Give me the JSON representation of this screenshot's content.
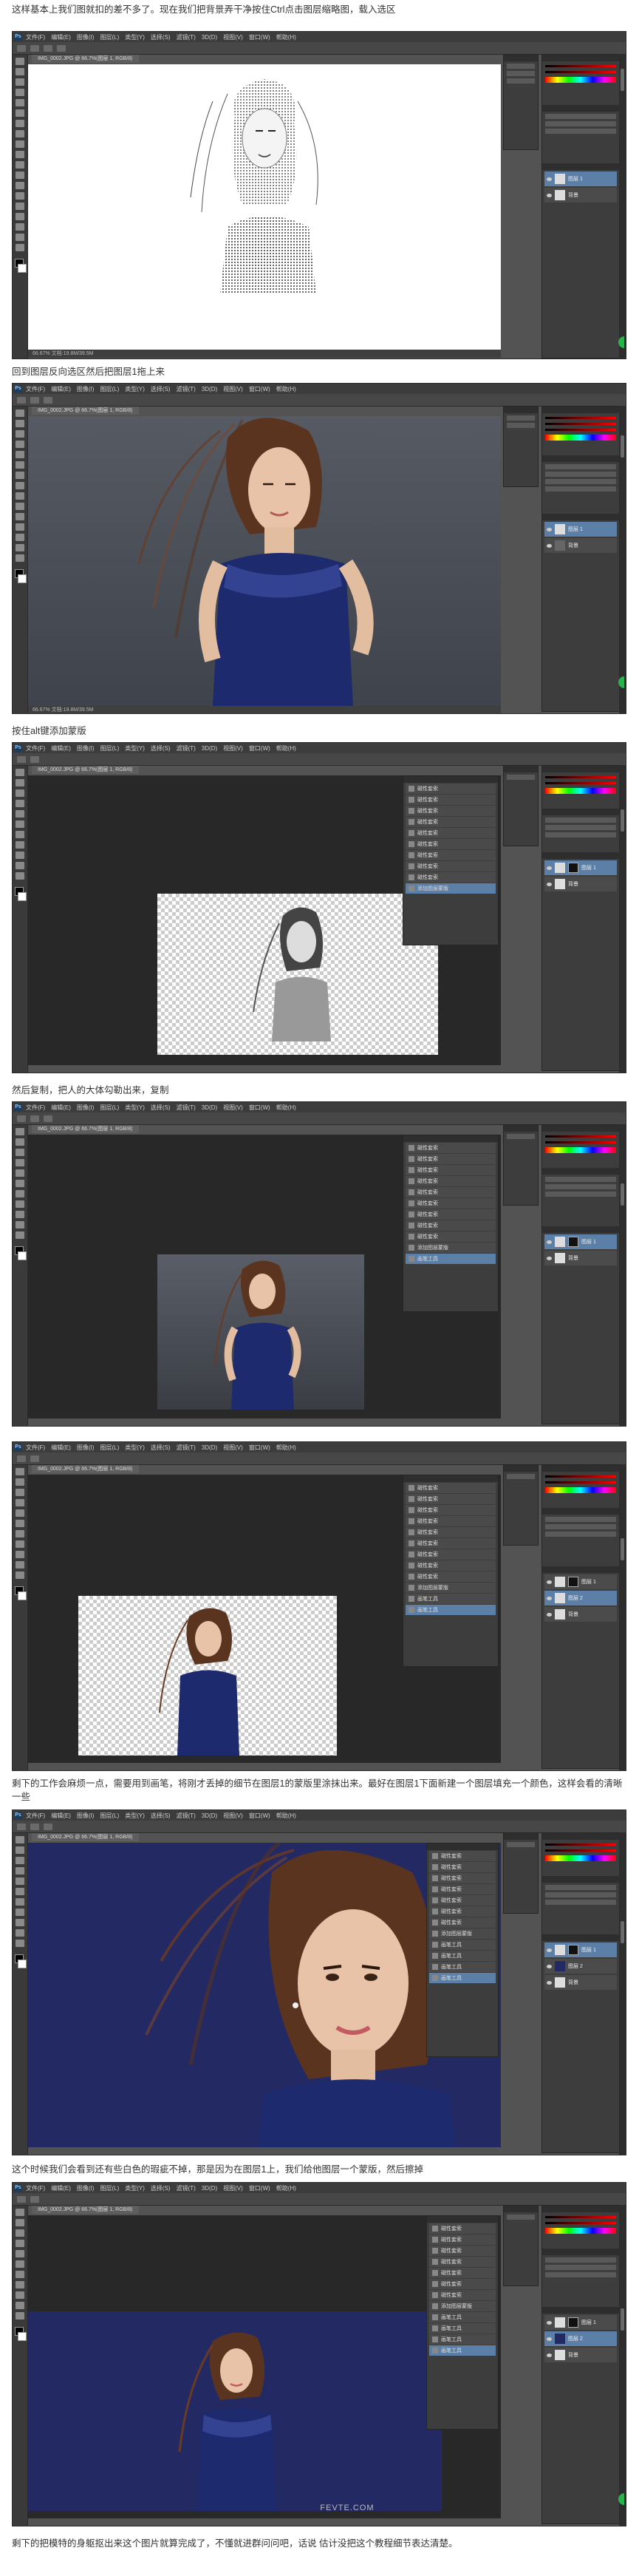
{
  "captions": [
    "这样基本上我们图就扣的差不多了。现在我们把背景弄干净按住Ctrl点击图层缩略图，载入选区",
    "回到图层反向选区然后把图层1拖上来",
    "按住alt键添加蒙版",
    "然后复制，把人的大体勾勒出来，复制",
    "剩下的工作会麻烦一点，需要用到画笔，将刚才丢掉的细节在图层1的蒙版里涂抹出来。最好在图层1下面新建一个图层填充一个颜色，这样会看的清晰一些",
    "这个时候我们会看到还有些白色的瑕疵不掉，那是因为在图层1上，我们给他图层一个蒙版，然后擦掉",
    "剩下的把模特的身躯抠出来这个图片就算完成了，不懂就进群问问吧，话说 估计没把这个教程细节表达清楚。"
  ],
  "ps": {
    "logo": "Ps",
    "menu": [
      "文件(F)",
      "编辑(E)",
      "图像(I)",
      "图层(L)",
      "类型(Y)",
      "选择(S)",
      "滤镜(T)",
      "3D(D)",
      "视图(V)",
      "窗口(W)",
      "帮助(H)"
    ],
    "doc_tab": "IMG_0002.JPG @ 66.7%(图层 1, RGB/8)",
    "status": "66.67%    文档:19.8M/39.5M"
  },
  "history_items": [
    "磁性套索",
    "磁性套索",
    "磁性套索",
    "磁性套索",
    "磁性套索",
    "磁性套索",
    "磁性套索",
    "磁性套索",
    "磁性套索",
    "添加图层蒙版",
    "画笔工具",
    "画笔工具",
    "画笔工具",
    "画笔工具"
  ],
  "layers": {
    "layer1": "图层 1",
    "layer2": "图层 2",
    "background": "背景"
  },
  "watermark": "FEVTE.COM",
  "colors": {
    "ps_bg": "#535353",
    "panel": "#3d3d3d",
    "selected": "#5b7fa6",
    "navy_bg": "#232a63",
    "gray_bg": "#4a4e58",
    "badge": "#26b34a"
  }
}
